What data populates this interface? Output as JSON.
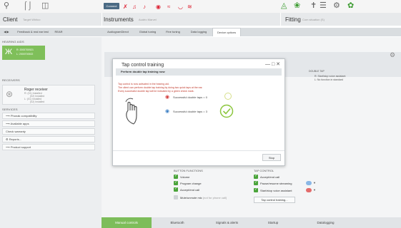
{
  "toolbar": {
    "connect_label": "Connect"
  },
  "header": {
    "client_label": "Client",
    "client_name": "Target Whitco",
    "instruments_label": "Instruments",
    "instruments_sub": "Audéo Marvel",
    "fitting_label": "Fitting",
    "fitting_sub": "Com situation (S)"
  },
  "tabs": [
    {
      "label": "Feedback & real ear test",
      "active": false
    },
    {
      "label": "REAR",
      "active": false
    },
    {
      "label": "AudiogramDirect",
      "active": false
    },
    {
      "label": "Global tuning",
      "active": false
    },
    {
      "label": "Fine tuning",
      "active": false
    },
    {
      "label": "Data logging",
      "active": false
    },
    {
      "label": "Device options",
      "active": true
    }
  ],
  "left": {
    "hearing_aids_title": "HEARING AIDS",
    "hearing_aid_lines": [
      "R: 2000700921",
      "L: 2000700922"
    ],
    "receivers_title": "RECEIVERS",
    "receiver_name": "Roger receiver",
    "receiver_lines": [
      "R: (01) Installed",
      "(02) Installed",
      "L: (01) Installed",
      "(02) Installed"
    ],
    "services_title": "SERVICES",
    "services": [
      "Phonak compatibility",
      "Available apps",
      "Check warranty",
      "Reports...",
      "Product support"
    ]
  },
  "main": {
    "double_tap_title": "DOUBLE TAP",
    "double_tap_options": [
      "R: Start/stop voice assistant",
      "L: No function in standard"
    ]
  },
  "dialog": {
    "title": "Tap control training",
    "bar_text": "Perform double tap training now",
    "lines": [
      "Tap control is now activated in the hearing aid.",
      "The client can perform double tap training by doing two quick taps at the ear.",
      "Every successful double tap will be indicated by a green check mark."
    ],
    "status_right": "Successful double taps = 0",
    "status_left": "Successful double taps = 3",
    "stop_label": "Stop"
  },
  "button_functions": {
    "title": "BUTTON FUNCTIONS",
    "items": [
      {
        "label": "Volume",
        "checked": true
      },
      {
        "label": "Program change",
        "checked": true
      },
      {
        "label": "Accept/end call",
        "checked": true
      },
      {
        "label": "Mute/unmute mic",
        "hint": "(not for phone call)",
        "checked": false
      }
    ]
  },
  "tap_control": {
    "title": "TAP CONTROL",
    "items": [
      {
        "label": "Accept/end call",
        "checked": true
      },
      {
        "label": "Pause/resume streaming",
        "checked": true
      },
      {
        "label": "Start/stop voice assistant",
        "checked": true
      }
    ],
    "training_button": "Tap control training..."
  },
  "bottom_tabs": [
    {
      "label": "Manual controls",
      "active": true
    },
    {
      "label": "Bluetooth",
      "active": false
    },
    {
      "label": "Signals & alerts",
      "active": false
    },
    {
      "label": "Startup",
      "active": false
    },
    {
      "label": "Datalogging",
      "active": false
    }
  ],
  "colors": {
    "accent_green": "#7dbd5a",
    "alert_red": "#d23a3a",
    "tab_bar": "#d9dde0"
  }
}
